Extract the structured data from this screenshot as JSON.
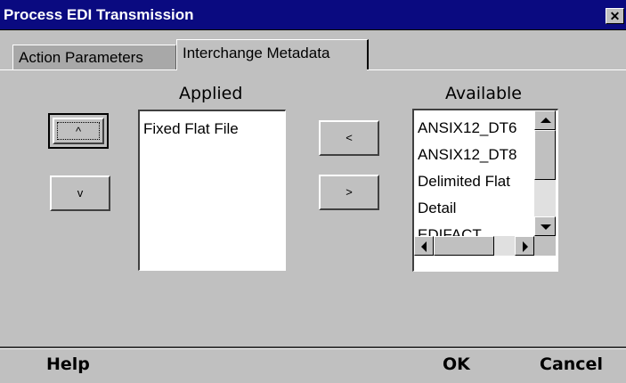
{
  "window": {
    "title": "Process EDI Transmission",
    "close_glyph": "✕"
  },
  "tabs": [
    {
      "label": "Action Parameters",
      "active": false
    },
    {
      "label": "Interchange Metadata",
      "active": true
    }
  ],
  "applied": {
    "heading": "Applied",
    "items": [
      "Fixed Flat File"
    ]
  },
  "available": {
    "heading": "Available",
    "items": [
      "ANSIX12_DT6",
      "ANSIX12_DT8",
      "Delimited Flat",
      "Detail",
      "EDIFACT"
    ]
  },
  "buttons": {
    "move_up": "^",
    "move_down": "v",
    "add_to_applied": "<",
    "remove_from_applied": ">"
  },
  "footer": {
    "help": "Help",
    "ok": "OK",
    "cancel": "Cancel"
  },
  "colors": {
    "title_bar": "#0a0a80",
    "background": "#c0c0c0"
  }
}
